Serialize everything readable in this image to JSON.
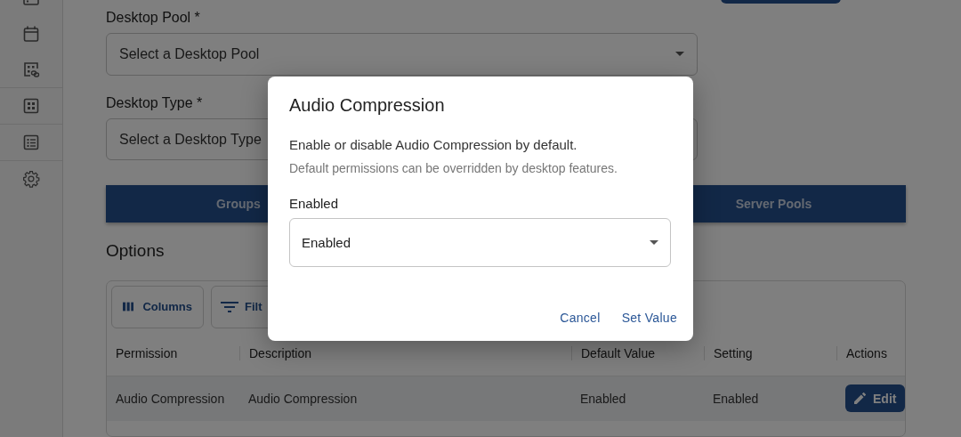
{
  "form": {
    "fields": [
      {
        "label": "Desktop Pool *",
        "placeholder": "Select a Desktop Pool"
      },
      {
        "label": "Desktop Type *",
        "placeholder": "Select a Desktop Type"
      }
    ]
  },
  "tabs": [
    {
      "label": "Groups"
    },
    {
      "label": "Server Pools"
    }
  ],
  "options": {
    "title": "Options",
    "toolbar": [
      {
        "kind": "columns",
        "label": "Columns"
      },
      {
        "kind": "filter",
        "label": "Filt"
      }
    ],
    "columns": [
      "Permission",
      "Description",
      "Default Value",
      "Setting",
      "Actions"
    ],
    "rows": [
      {
        "cells": [
          "Audio Compression",
          "Audio Compression",
          "Enabled",
          "Enabled"
        ],
        "action": "Edit"
      }
    ]
  },
  "dialog": {
    "title": "Audio Compression",
    "description": "Enable or disable Audio Compression by default.",
    "hint": "Default permissions can be overridden by desktop features.",
    "field_label": "Enabled",
    "value": "Enabled",
    "buttons": [
      "Cancel",
      "Set Value"
    ]
  }
}
